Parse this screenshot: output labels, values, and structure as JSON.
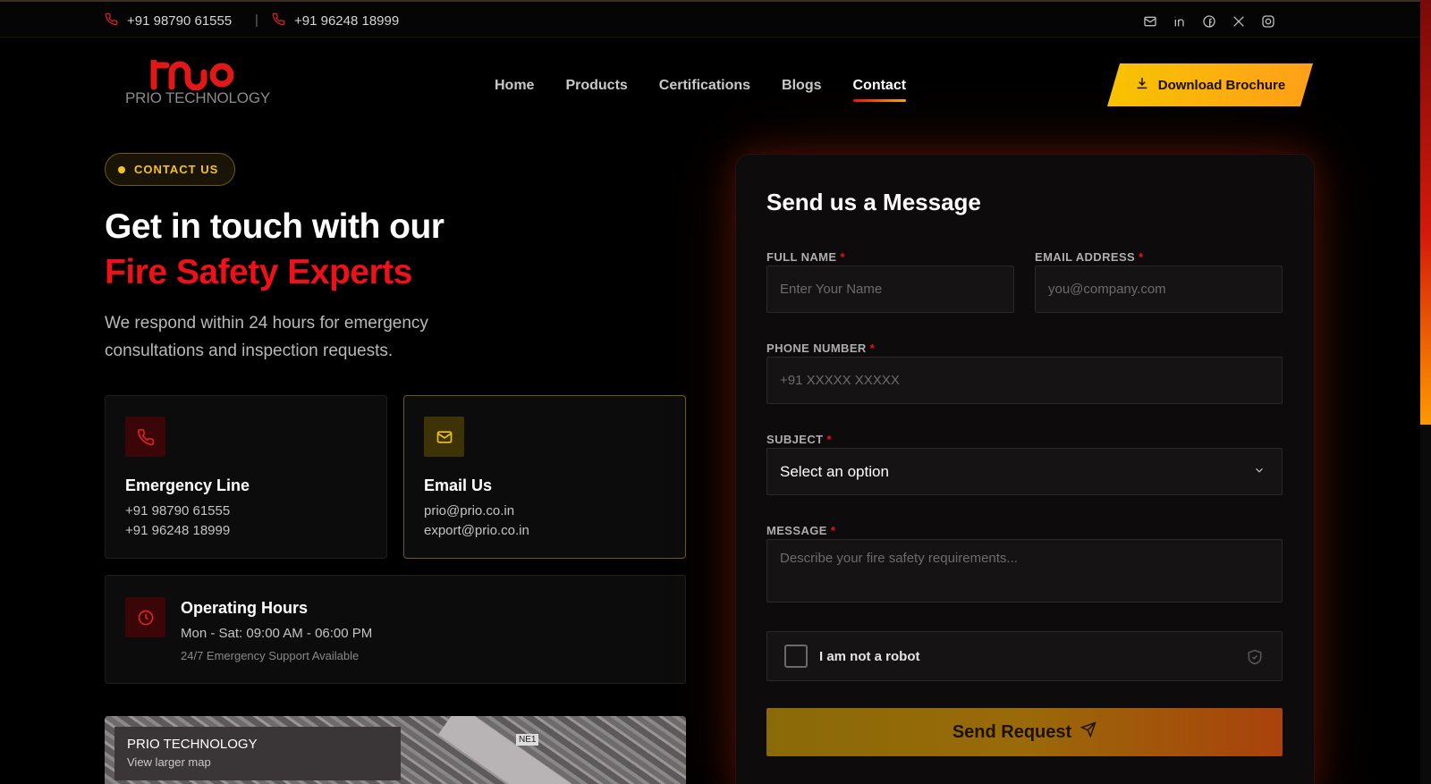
{
  "topbar": {
    "phone_1": "+91 98790 61555",
    "separator": "|",
    "phone_2": "+91 96248 18999",
    "socials": [
      "mail-icon",
      "linkedin-icon",
      "facebook-icon",
      "x-icon",
      "instagram-icon"
    ]
  },
  "nav": {
    "brand": "PRIO TECHNOLOGY",
    "items": [
      {
        "label": "Home",
        "active": false
      },
      {
        "label": "Products",
        "active": false
      },
      {
        "label": "Certifications",
        "active": false
      },
      {
        "label": "Blogs",
        "active": false
      },
      {
        "label": "Contact",
        "active": true
      }
    ],
    "cta_label": "Download Brochure"
  },
  "hero": {
    "badge": "CONTACT US",
    "headline_1": "Get in touch with our",
    "headline_2": "Fire Safety Experts",
    "lead": "We respond within 24 hours for emergency consultations and inspection requests."
  },
  "cards": {
    "emergency": {
      "title": "Emergency Line",
      "line_1": "+91 98790 61555",
      "line_2": "+91 96248 18999"
    },
    "email": {
      "title": "Email Us",
      "line_1": "prio@prio.co.in",
      "line_2": "export@prio.co.in"
    },
    "hours": {
      "title": "Operating Hours",
      "line_1": "Mon - Sat: 09:00 AM - 06:00 PM",
      "line_2": "24/7 Emergency Support Available"
    }
  },
  "map": {
    "name": "PRIO TECHNOLOGY",
    "link": "View larger map",
    "road_tag": "NE1"
  },
  "form": {
    "title": "Send us a Message",
    "required_mark": "*",
    "full_name_label": "FULL NAME",
    "full_name_placeholder": "Enter Your Name",
    "email_label": "EMAIL ADDRESS",
    "email_placeholder": "you@company.com",
    "phone_label": "PHONE NUMBER",
    "phone_placeholder": "+91 XXXXX XXXXX",
    "subject_label": "SUBJECT",
    "subject_value": "Select an option",
    "message_label": "MESSAGE",
    "message_placeholder": "Describe your fire safety requirements...",
    "captcha_label": "I am not a robot",
    "submit_label": "Send Request"
  },
  "colors": {
    "accent_red": "#f0101a",
    "accent_yellow": "#f3c419",
    "background": "#000000"
  }
}
